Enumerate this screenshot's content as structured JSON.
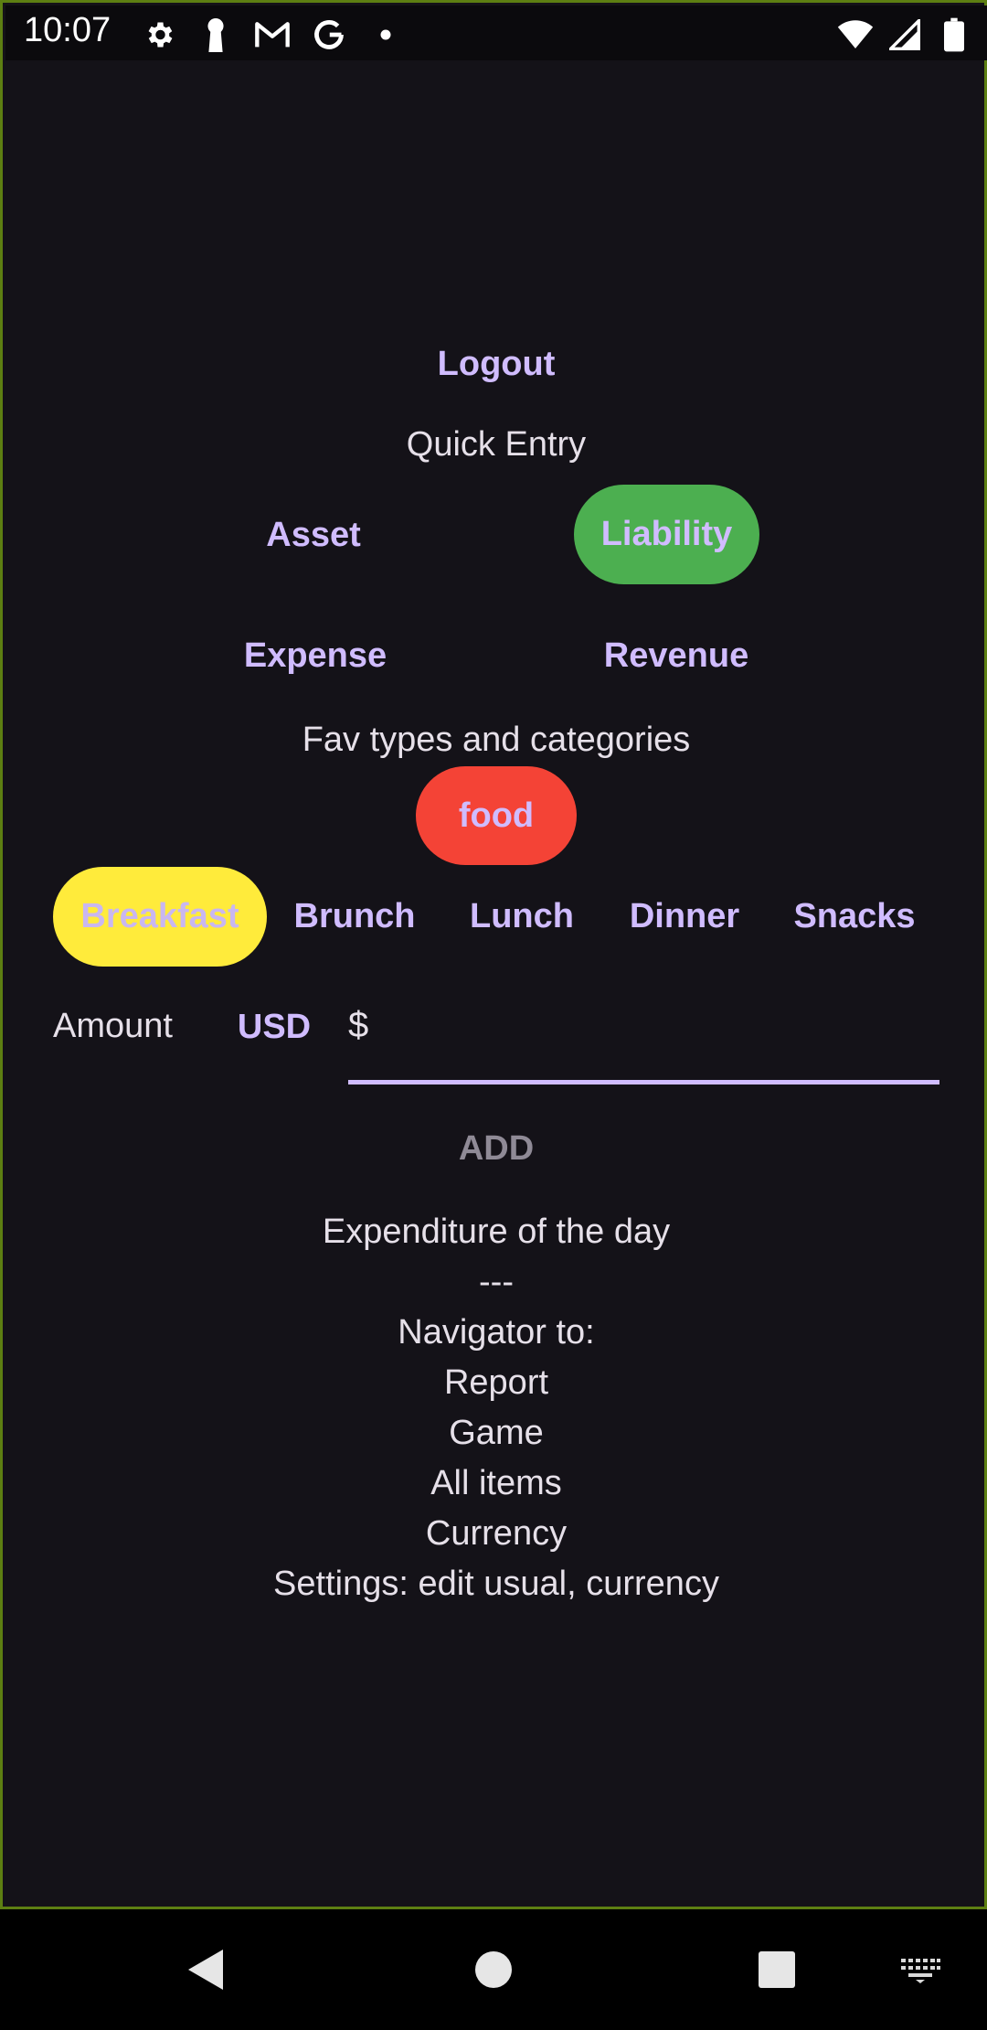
{
  "status_bar": {
    "time": "10:07",
    "left_icons": [
      "gear-icon",
      "keyhole-icon",
      "gmail-icon",
      "google-icon",
      "dot-icon"
    ],
    "right_icons": [
      "wifi-icon",
      "signal-icon",
      "battery-icon"
    ]
  },
  "header": {
    "logout_label": "Logout",
    "quick_entry_label": "Quick Entry"
  },
  "account_types": {
    "asset": "Asset",
    "liability": "Liability",
    "expense": "Expense",
    "revenue": "Revenue",
    "selected": "Liability",
    "selected_color": "#4caf50"
  },
  "favorites": {
    "heading": "Fav types and categories",
    "category": "food",
    "category_color": "#f44336"
  },
  "meals": {
    "items": [
      "Breakfast",
      "Brunch",
      "Lunch",
      "Dinner",
      "Snacks"
    ],
    "selected": "Breakfast",
    "selected_color": "#ffeb3b"
  },
  "amount": {
    "label": "Amount",
    "currency": "USD",
    "prefix": "$",
    "value": ""
  },
  "add_button": "ADD",
  "info": {
    "lines": [
      "Expenditure of the day",
      "---",
      "Navigator to:",
      "Report",
      "Game",
      "All items",
      "Currency",
      "Settings: edit usual, currency"
    ]
  },
  "nav_bar": {
    "icons": [
      "back-icon",
      "home-icon",
      "recents-icon",
      "keyboard-icon"
    ]
  },
  "colors": {
    "background": "#141218",
    "accent": "#d0bcff",
    "text": "#e6e0e9"
  }
}
